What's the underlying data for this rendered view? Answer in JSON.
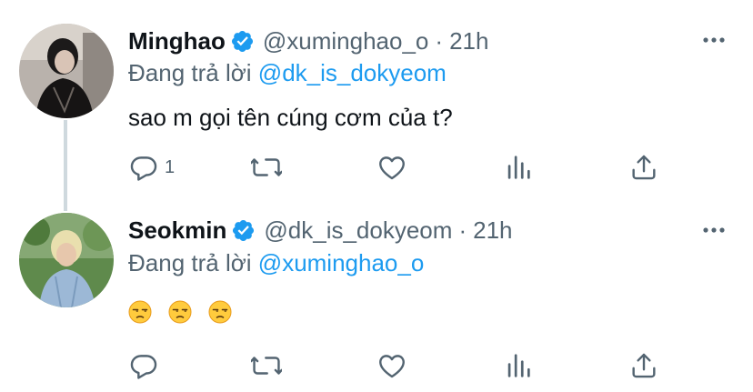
{
  "tweets": [
    {
      "name": "Minghao",
      "handle": "@xuminghao_o",
      "dot": "·",
      "time": "21h",
      "replying_prefix": "Đang trả lời",
      "replying_to": "@dk_is_dokyeom",
      "text": "sao m gọi tên cúng cơm của t?",
      "reply_count": "1"
    },
    {
      "name": "Seokmin",
      "handle": "@dk_is_dokyeom",
      "dot": "·",
      "time": "21h",
      "replying_prefix": "Đang trả lời",
      "replying_to": "@xuminghao_o",
      "text_emoji": [
        "😒",
        "😒",
        "😒"
      ],
      "reply_count": ""
    }
  ],
  "colors": {
    "accent": "#1d9bf0",
    "muted": "#536471",
    "text": "#0f1419",
    "thread": "#cfd9de"
  },
  "icons": [
    "verified-badge-icon",
    "more-icon",
    "reply-icon",
    "retweet-icon",
    "like-icon",
    "analytics-icon",
    "share-icon"
  ]
}
